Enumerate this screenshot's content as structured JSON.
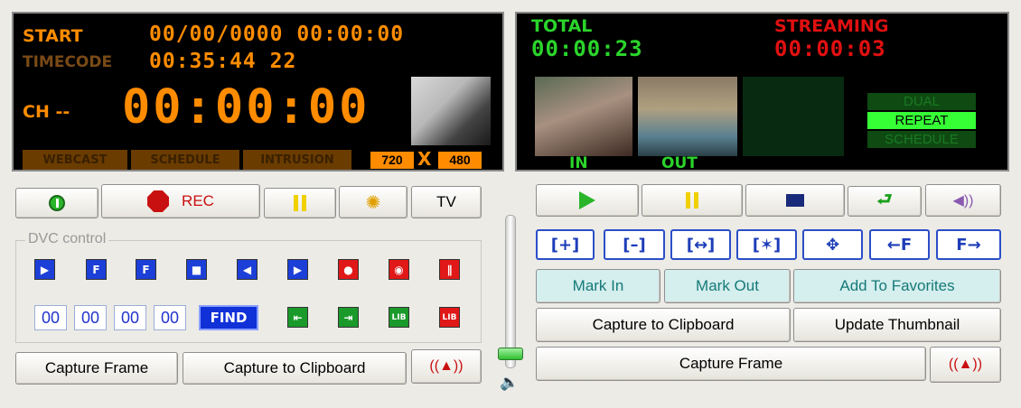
{
  "left_display": {
    "start_label": "START",
    "start_value": "00/00/0000  00:00:00",
    "timecode_label": "TIMECODE",
    "timecode_value": "00:35:44 22",
    "channel_label": "CH --",
    "main_time": "00:00:00",
    "tags": [
      "WEBCAST",
      "SCHEDULE",
      "INTRUSION"
    ],
    "res_w": "720",
    "res_x": "X",
    "res_h": "480"
  },
  "right_display": {
    "total_label": "TOTAL",
    "total_value": "00:00:23",
    "streaming_label": "STREAMING",
    "streaming_value": "00:00:03",
    "in_label": "IN",
    "out_label": "OUT",
    "modes": [
      "DUAL",
      "REPEAT",
      "SCHEDULE"
    ]
  },
  "left_controls": {
    "rec_label": "REC",
    "tv_label": "TV",
    "dvc_legend": "DVC control",
    "timecode_fields": [
      "00",
      "00",
      "00",
      "00"
    ],
    "find_label": "FIND",
    "capture_frame": "Capture Frame",
    "capture_clipboard": "Capture to Clipboard"
  },
  "right_controls": {
    "zoom_buttons": [
      "[+]",
      "[–]",
      "[↔]",
      "[✶]",
      "✥",
      "←F",
      "F→"
    ],
    "mark_in": "Mark In",
    "mark_out": "Mark Out",
    "add_favorites": "Add To Favorites",
    "capture_clipboard": "Capture to Clipboard",
    "update_thumbnail": "Update Thumbnail",
    "capture_frame": "Capture Frame"
  },
  "colors": {
    "segment_orange": "#ff8c00",
    "segment_green": "#2bd42b",
    "segment_red": "#e01010"
  }
}
